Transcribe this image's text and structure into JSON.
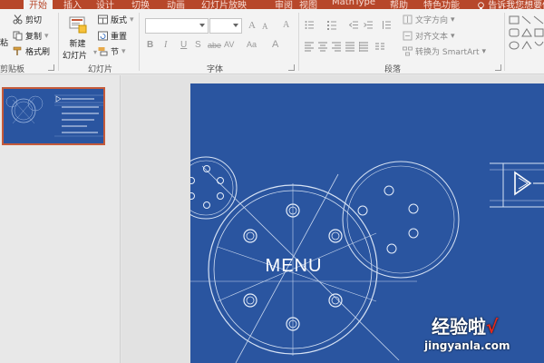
{
  "tabs": {
    "home": "开始",
    "insert": "插入",
    "design": "设计",
    "transitions": "切换",
    "animations": "动画",
    "slideshow": "幻灯片放映",
    "review": "审阅",
    "view": "视图",
    "mathtype": "MathType",
    "help": "帮助",
    "special": "特色功能",
    "search": "告诉我您想要做"
  },
  "clipboard": {
    "paste_partial": "粘",
    "cut": "剪切",
    "copy": "复制",
    "format_painter": "格式刷",
    "label": "剪贴板"
  },
  "slides_group": {
    "new_slide_line1": "新建",
    "new_slide_line2": "幻灯片",
    "layout": "版式",
    "reset": "重置",
    "section": "节",
    "label": "幻灯片"
  },
  "font_group": {
    "bold": "B",
    "italic": "I",
    "underline": "U",
    "shadow": "S",
    "strike": "abe",
    "spacing": "AV",
    "case": "Aa",
    "grow": "A",
    "shrink": "A",
    "clear": "A",
    "color": "A",
    "label": "字体"
  },
  "paragraph_group": {
    "text_direction": "文字方向",
    "align_text": "对齐文本",
    "smartart": "转换为 SmartArt",
    "label": "段落"
  },
  "slide": {
    "title": "MENU"
  },
  "watermark": {
    "top": "经验啦",
    "check": "√",
    "bottom": "jingyanla.com"
  },
  "colors": {
    "tab_bar": "#b7472a",
    "slide_bg": "#2a55a0",
    "selection": "#c55a3a"
  }
}
